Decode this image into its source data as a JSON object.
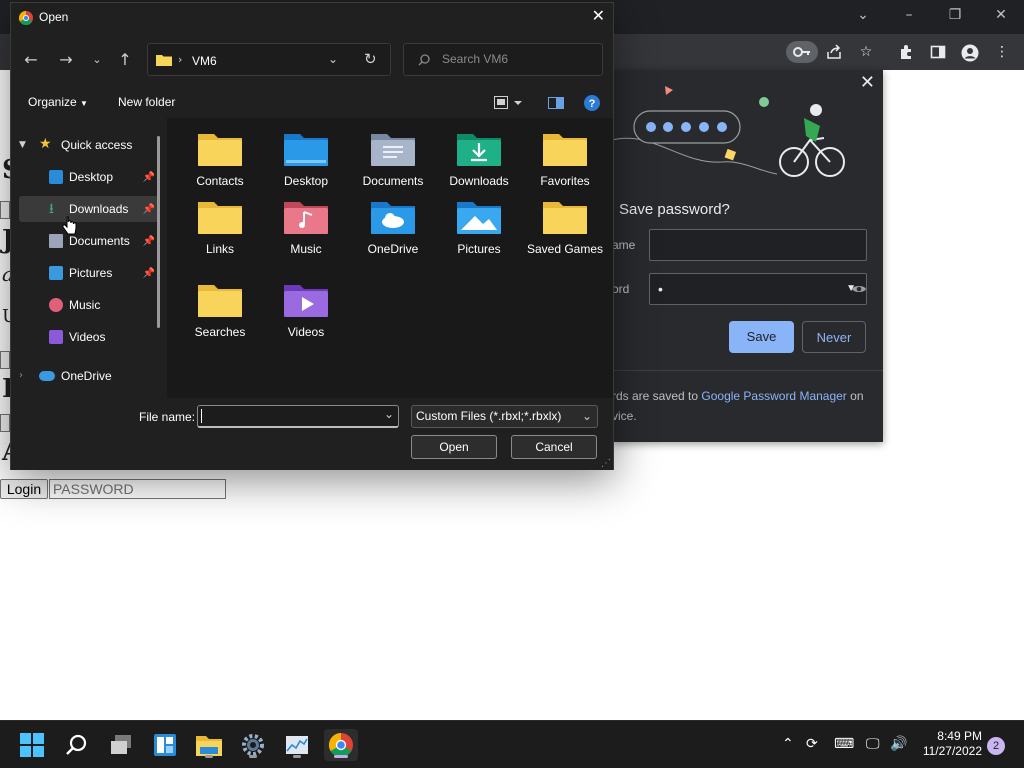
{
  "dialog": {
    "title": "Open",
    "address_folder": "VM6",
    "search_placeholder": "Search VM6",
    "organize_label": "Organize",
    "new_folder_label": "New folder",
    "nav": {
      "quick_access": "Quick access",
      "items": [
        "Desktop",
        "Downloads",
        "Documents",
        "Pictures",
        "Music",
        "Videos"
      ],
      "onedrive": "OneDrive"
    },
    "files": [
      {
        "label": "Contacts"
      },
      {
        "label": "Desktop"
      },
      {
        "label": "Documents"
      },
      {
        "label": "Downloads"
      },
      {
        "label": "Favorites"
      },
      {
        "label": "Links"
      },
      {
        "label": "Music"
      },
      {
        "label": "OneDrive"
      },
      {
        "label": "Pictures"
      },
      {
        "label": "Saved Games"
      },
      {
        "label": "Searches"
      },
      {
        "label": "Videos"
      }
    ],
    "file_name_label": "File name:",
    "file_name_value": "",
    "file_type": "Custom Files (*.rbxl;*.rbxlx)",
    "open_button": "Open",
    "cancel_button": "Cancel"
  },
  "save_password": {
    "title": "Save password?",
    "username_label_partial": "ame",
    "password_label_partial": "ord",
    "password_value": "•",
    "save_button": "Save",
    "never_button": "Never",
    "footer_text_start": "rds are saved to ",
    "footer_link": "Google Password Manager",
    "footer_text_end": " on",
    "footer_text_line2": "vice."
  },
  "page": {
    "login_button": "Login",
    "password_placeholder": "PASSWORD",
    "letters": [
      "S",
      "J",
      "a",
      "U",
      "K",
      "A"
    ]
  },
  "taskbar": {
    "time": "8:49 PM",
    "date": "11/27/2022",
    "notification_count": "2"
  },
  "colors": {
    "save_button_bg": "#8ab4f8",
    "link": "#8ab4f8",
    "folder_yellow": "#f8d55a",
    "dialog_bg": "#202020"
  }
}
